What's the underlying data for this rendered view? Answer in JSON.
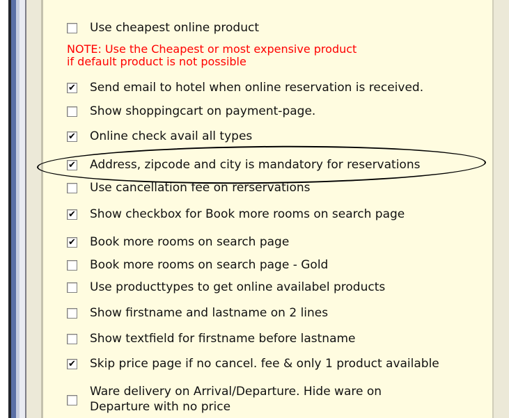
{
  "note": {
    "line1": "NOTE: Use the Cheapest or most expensive product",
    "line2": "if default product is not possible"
  },
  "options": [
    {
      "label": "Use cheapest online product",
      "checked": false
    },
    {
      "label": "Send email to hotel when online reservation is received.",
      "checked": true
    },
    {
      "label": "Show shoppingcart on payment-page.",
      "checked": false
    },
    {
      "label": "Online check avail all types",
      "checked": true
    },
    {
      "label": "Address, zipcode and city is mandatory for reservations",
      "checked": true
    },
    {
      "label": "Use cancellation fee on rerservations",
      "checked": false
    },
    {
      "label": "Show checkbox for Book more rooms on search page",
      "checked": true
    },
    {
      "label": "Book more rooms on search page",
      "checked": true
    },
    {
      "label": "Book more rooms on search page - Gold",
      "checked": false
    },
    {
      "label": "Use producttypes to get online availabel products",
      "checked": false
    },
    {
      "label": "Show firstname and lastname on 2 lines",
      "checked": false
    },
    {
      "label": "Show textfield for firstname before lastname",
      "checked": false
    },
    {
      "label": "Skip price page if no cancel. fee & only 1 product available",
      "checked": true
    }
  ],
  "ware_option": {
    "line1": "Ware delivery on Arrival/Departure. Hide ware on",
    "line2": "Departure with no price",
    "checked": false
  },
  "check_glyph": "✔",
  "colors": {
    "panel_bg": "#fffce0",
    "note_text": "#ff0000",
    "highlight_oval": "#000000"
  }
}
